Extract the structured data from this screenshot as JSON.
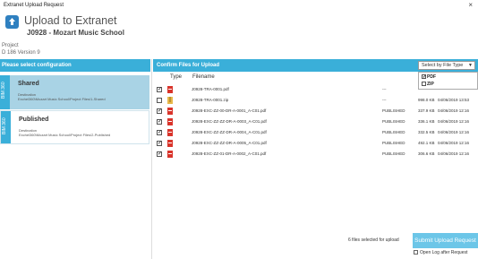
{
  "window": {
    "title": "Extranet Upload Request",
    "close_glyph": "×"
  },
  "header": {
    "title": "Upload to Extranet",
    "subtitle": "J0928 - Mozart Music School"
  },
  "project": {
    "label": "Project",
    "id_line": "D 186 Version 9"
  },
  "config": {
    "heading": "Please select configuration",
    "cards": [
      {
        "tab": "BIM 360",
        "title": "Shared",
        "dest_label": "Destination",
        "dest": "Exchel360\\Mozart Music School\\Project Files\\1-Shared",
        "selected": true
      },
      {
        "tab": "BIM 360",
        "title": "Published",
        "dest_label": "Destination",
        "dest": "Exchel360\\Mozart Music School\\Project Files\\2-Published",
        "selected": false
      }
    ]
  },
  "files": {
    "heading": "Confirm Files for Upload",
    "filter_label": "Select by File Type",
    "filter_options": [
      {
        "label": "PDF",
        "checked": true
      },
      {
        "label": "ZIP",
        "checked": false
      }
    ],
    "columns": {
      "type": "Type",
      "filename": "Filename"
    },
    "rows": [
      {
        "checked": true,
        "icon": "pdf-icon",
        "name": "J0928-TRA-0001.pdf",
        "status": "---",
        "size": "",
        "date": ""
      },
      {
        "checked": false,
        "icon": "zip-icon",
        "name": "J0928-TRA-0001.zip",
        "status": "---",
        "size": "998.0 KB",
        "date": "04/06/2019 13:53"
      },
      {
        "checked": true,
        "icon": "pdf-icon",
        "name": "J0928-EXC-ZZ-00-DR-A-0001_A-C01.pdf",
        "status": "PUBLISHED",
        "size": "337.9 KB",
        "date": "04/06/2019 12:16"
      },
      {
        "checked": true,
        "icon": "pdf-icon",
        "name": "J0928-EXC-ZZ-ZZ-DR-A-0003_A-C01.pdf",
        "status": "PUBLISHED",
        "size": "336.1 KB",
        "date": "04/06/2019 12:16"
      },
      {
        "checked": true,
        "icon": "pdf-icon",
        "name": "J0928-EXC-ZZ-ZZ-DR-A-0004_A-C01.pdf",
        "status": "PUBLISHED",
        "size": "332.5 KB",
        "date": "04/06/2019 12:16"
      },
      {
        "checked": true,
        "icon": "pdf-icon",
        "name": "J0928-EXC-ZZ-ZZ-DR-A-0005_A-C01.pdf",
        "status": "PUBLISHED",
        "size": "492.1 KB",
        "date": "04/06/2019 12:16"
      },
      {
        "checked": true,
        "icon": "pdf-icon",
        "name": "J0928-EXC-ZZ-01-DR-A-0002_A-C01.pdf",
        "status": "PUBLISHED",
        "size": "306.6 KB",
        "date": "04/06/2019 12:16"
      }
    ]
  },
  "footer": {
    "selected_count": "6 files selected for upload",
    "submit_label": "Submit Upload Request",
    "open_log_label": "Open Log after Request"
  },
  "colors": {
    "accent": "#3aafd9",
    "selected_card": "#a9d3e5",
    "submit": "#6cc6e8"
  }
}
